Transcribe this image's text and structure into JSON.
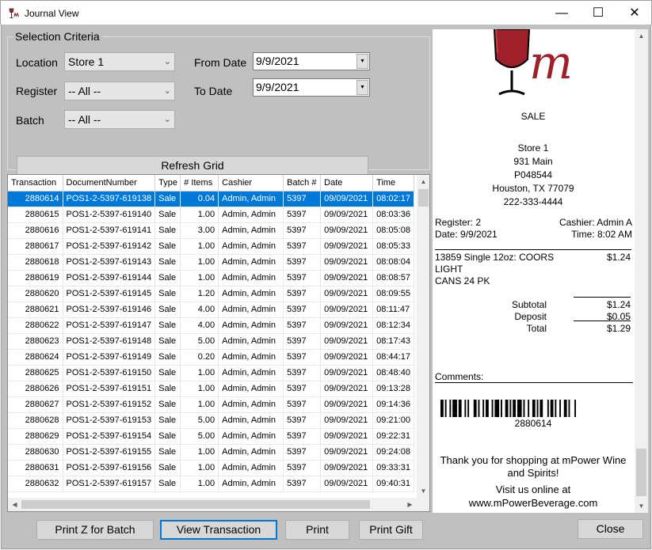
{
  "window": {
    "title": "Journal View",
    "minimize_glyph": "—",
    "maximize_glyph": "☐",
    "close_glyph": "✕"
  },
  "criteria": {
    "group_label": "Selection Criteria",
    "location_label": "Location",
    "location_value": "Store 1",
    "register_label": "Register",
    "register_value": "-- All --",
    "batch_label": "Batch",
    "batch_value": "-- All --",
    "from_date_label": "From Date",
    "from_date_value": "9/9/2021",
    "to_date_label": "To Date",
    "to_date_value": "9/9/2021",
    "refresh_label": "Refresh Grid"
  },
  "grid": {
    "columns": [
      "Transaction",
      "DocumentNumber",
      "Type",
      "# Items",
      "Cashier",
      "Batch #",
      "Date",
      "Time"
    ],
    "rows": [
      [
        "2880614",
        "POS1-2-5397-619138",
        "Sale",
        "0.04",
        "Admin, Admin",
        "5397",
        "09/09/2021",
        "08:02:17"
      ],
      [
        "2880615",
        "POS1-2-5397-619140",
        "Sale",
        "1.00",
        "Admin, Admin",
        "5397",
        "09/09/2021",
        "08:03:36"
      ],
      [
        "2880616",
        "POS1-2-5397-619141",
        "Sale",
        "3.00",
        "Admin, Admin",
        "5397",
        "09/09/2021",
        "08:05:08"
      ],
      [
        "2880617",
        "POS1-2-5397-619142",
        "Sale",
        "1.00",
        "Admin, Admin",
        "5397",
        "09/09/2021",
        "08:05:33"
      ],
      [
        "2880618",
        "POS1-2-5397-619143",
        "Sale",
        "1.00",
        "Admin, Admin",
        "5397",
        "09/09/2021",
        "08:08:04"
      ],
      [
        "2880619",
        "POS1-2-5397-619144",
        "Sale",
        "1.00",
        "Admin, Admin",
        "5397",
        "09/09/2021",
        "08:08:57"
      ],
      [
        "2880620",
        "POS1-2-5397-619145",
        "Sale",
        "1.20",
        "Admin, Admin",
        "5397",
        "09/09/2021",
        "08:09:55"
      ],
      [
        "2880621",
        "POS1-2-5397-619146",
        "Sale",
        "4.00",
        "Admin, Admin",
        "5397",
        "09/09/2021",
        "08:11:47"
      ],
      [
        "2880622",
        "POS1-2-5397-619147",
        "Sale",
        "4.00",
        "Admin, Admin",
        "5397",
        "09/09/2021",
        "08:12:34"
      ],
      [
        "2880623",
        "POS1-2-5397-619148",
        "Sale",
        "5.00",
        "Admin, Admin",
        "5397",
        "09/09/2021",
        "08:17:43"
      ],
      [
        "2880624",
        "POS1-2-5397-619149",
        "Sale",
        "0.20",
        "Admin, Admin",
        "5397",
        "09/09/2021",
        "08:44:17"
      ],
      [
        "2880625",
        "POS1-2-5397-619150",
        "Sale",
        "1.00",
        "Admin, Admin",
        "5397",
        "09/09/2021",
        "08:48:40"
      ],
      [
        "2880626",
        "POS1-2-5397-619151",
        "Sale",
        "1.00",
        "Admin, Admin",
        "5397",
        "09/09/2021",
        "09:13:28"
      ],
      [
        "2880627",
        "POS1-2-5397-619152",
        "Sale",
        "1.00",
        "Admin, Admin",
        "5397",
        "09/09/2021",
        "09:14:36"
      ],
      [
        "2880628",
        "POS1-2-5397-619153",
        "Sale",
        "5.00",
        "Admin, Admin",
        "5397",
        "09/09/2021",
        "09:21:00"
      ],
      [
        "2880629",
        "POS1-2-5397-619154",
        "Sale",
        "5.00",
        "Admin, Admin",
        "5397",
        "09/09/2021",
        "09:22:31"
      ],
      [
        "2880630",
        "POS1-2-5397-619155",
        "Sale",
        "1.00",
        "Admin, Admin",
        "5397",
        "09/09/2021",
        "09:24:08"
      ],
      [
        "2880631",
        "POS1-2-5397-619156",
        "Sale",
        "1.00",
        "Admin, Admin",
        "5397",
        "09/09/2021",
        "09:33:31"
      ],
      [
        "2880632",
        "POS1-2-5397-619157",
        "Sale",
        "1.00",
        "Admin, Admin",
        "5397",
        "09/09/2021",
        "09:40:31"
      ]
    ],
    "selected_row": 0
  },
  "receipt": {
    "sale_label": "SALE",
    "store_name": "Store 1",
    "address1": "931 Main",
    "store_code": "P048544",
    "city_line": "Houston, TX 77079",
    "phone": "222-333-4444",
    "register": "Register: 2",
    "cashier": "Cashier: Admin A",
    "date": "Date: 9/9/2021",
    "time": "Time: 8:02 AM",
    "item_line1": "13859 Single 12oz: COORS",
    "item_line2": "LIGHT",
    "item_line3": "CANS   24 PK",
    "item_price": "$1.24",
    "subtotal_label": "Subtotal",
    "subtotal_value": "$1.24",
    "deposit_label": "Deposit",
    "deposit_value": "$0.05",
    "total_label": "Total",
    "total_value": "$1.29",
    "comments_label": "Comments:",
    "barcode_number": "2880614",
    "thanks_line1": "Thank you for shopping at mPower Wine",
    "thanks_line2": "and Spirits!",
    "visit_line": "Visit us online at",
    "website": "www.mPowerBeverage.com",
    "logo_letter": "m",
    "logo_color": "#a0202a"
  },
  "buttons": {
    "print_z": "Print Z for Batch",
    "view_transaction": "View Transaction",
    "print": "Print",
    "print_gift": "Print Gift",
    "close": "Close"
  }
}
